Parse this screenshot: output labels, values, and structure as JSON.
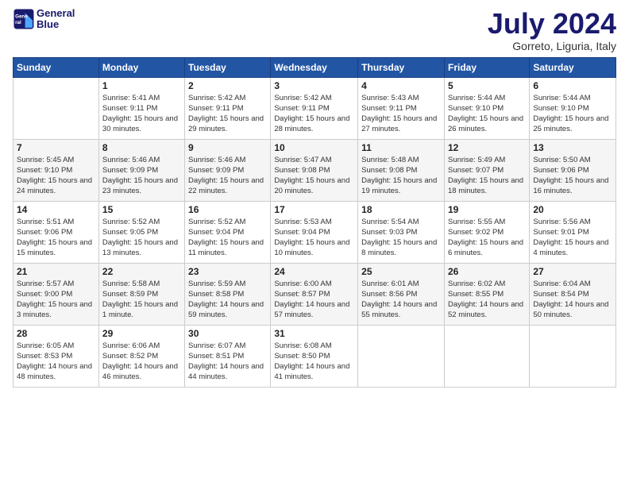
{
  "header": {
    "logo_line1": "General",
    "logo_line2": "Blue",
    "month": "July 2024",
    "location": "Gorreto, Liguria, Italy"
  },
  "days_of_week": [
    "Sunday",
    "Monday",
    "Tuesday",
    "Wednesday",
    "Thursday",
    "Friday",
    "Saturday"
  ],
  "weeks": [
    [
      {
        "day": "",
        "empty": true
      },
      {
        "day": "1",
        "sunrise": "Sunrise: 5:41 AM",
        "sunset": "Sunset: 9:11 PM",
        "daylight": "Daylight: 15 hours and 30 minutes."
      },
      {
        "day": "2",
        "sunrise": "Sunrise: 5:42 AM",
        "sunset": "Sunset: 9:11 PM",
        "daylight": "Daylight: 15 hours and 29 minutes."
      },
      {
        "day": "3",
        "sunrise": "Sunrise: 5:42 AM",
        "sunset": "Sunset: 9:11 PM",
        "daylight": "Daylight: 15 hours and 28 minutes."
      },
      {
        "day": "4",
        "sunrise": "Sunrise: 5:43 AM",
        "sunset": "Sunset: 9:11 PM",
        "daylight": "Daylight: 15 hours and 27 minutes."
      },
      {
        "day": "5",
        "sunrise": "Sunrise: 5:44 AM",
        "sunset": "Sunset: 9:10 PM",
        "daylight": "Daylight: 15 hours and 26 minutes."
      },
      {
        "day": "6",
        "sunrise": "Sunrise: 5:44 AM",
        "sunset": "Sunset: 9:10 PM",
        "daylight": "Daylight: 15 hours and 25 minutes."
      }
    ],
    [
      {
        "day": "7",
        "sunrise": "Sunrise: 5:45 AM",
        "sunset": "Sunset: 9:10 PM",
        "daylight": "Daylight: 15 hours and 24 minutes."
      },
      {
        "day": "8",
        "sunrise": "Sunrise: 5:46 AM",
        "sunset": "Sunset: 9:09 PM",
        "daylight": "Daylight: 15 hours and 23 minutes."
      },
      {
        "day": "9",
        "sunrise": "Sunrise: 5:46 AM",
        "sunset": "Sunset: 9:09 PM",
        "daylight": "Daylight: 15 hours and 22 minutes."
      },
      {
        "day": "10",
        "sunrise": "Sunrise: 5:47 AM",
        "sunset": "Sunset: 9:08 PM",
        "daylight": "Daylight: 15 hours and 20 minutes."
      },
      {
        "day": "11",
        "sunrise": "Sunrise: 5:48 AM",
        "sunset": "Sunset: 9:08 PM",
        "daylight": "Daylight: 15 hours and 19 minutes."
      },
      {
        "day": "12",
        "sunrise": "Sunrise: 5:49 AM",
        "sunset": "Sunset: 9:07 PM",
        "daylight": "Daylight: 15 hours and 18 minutes."
      },
      {
        "day": "13",
        "sunrise": "Sunrise: 5:50 AM",
        "sunset": "Sunset: 9:06 PM",
        "daylight": "Daylight: 15 hours and 16 minutes."
      }
    ],
    [
      {
        "day": "14",
        "sunrise": "Sunrise: 5:51 AM",
        "sunset": "Sunset: 9:06 PM",
        "daylight": "Daylight: 15 hours and 15 minutes."
      },
      {
        "day": "15",
        "sunrise": "Sunrise: 5:52 AM",
        "sunset": "Sunset: 9:05 PM",
        "daylight": "Daylight: 15 hours and 13 minutes."
      },
      {
        "day": "16",
        "sunrise": "Sunrise: 5:52 AM",
        "sunset": "Sunset: 9:04 PM",
        "daylight": "Daylight: 15 hours and 11 minutes."
      },
      {
        "day": "17",
        "sunrise": "Sunrise: 5:53 AM",
        "sunset": "Sunset: 9:04 PM",
        "daylight": "Daylight: 15 hours and 10 minutes."
      },
      {
        "day": "18",
        "sunrise": "Sunrise: 5:54 AM",
        "sunset": "Sunset: 9:03 PM",
        "daylight": "Daylight: 15 hours and 8 minutes."
      },
      {
        "day": "19",
        "sunrise": "Sunrise: 5:55 AM",
        "sunset": "Sunset: 9:02 PM",
        "daylight": "Daylight: 15 hours and 6 minutes."
      },
      {
        "day": "20",
        "sunrise": "Sunrise: 5:56 AM",
        "sunset": "Sunset: 9:01 PM",
        "daylight": "Daylight: 15 hours and 4 minutes."
      }
    ],
    [
      {
        "day": "21",
        "sunrise": "Sunrise: 5:57 AM",
        "sunset": "Sunset: 9:00 PM",
        "daylight": "Daylight: 15 hours and 3 minutes."
      },
      {
        "day": "22",
        "sunrise": "Sunrise: 5:58 AM",
        "sunset": "Sunset: 8:59 PM",
        "daylight": "Daylight: 15 hours and 1 minute."
      },
      {
        "day": "23",
        "sunrise": "Sunrise: 5:59 AM",
        "sunset": "Sunset: 8:58 PM",
        "daylight": "Daylight: 14 hours and 59 minutes."
      },
      {
        "day": "24",
        "sunrise": "Sunrise: 6:00 AM",
        "sunset": "Sunset: 8:57 PM",
        "daylight": "Daylight: 14 hours and 57 minutes."
      },
      {
        "day": "25",
        "sunrise": "Sunrise: 6:01 AM",
        "sunset": "Sunset: 8:56 PM",
        "daylight": "Daylight: 14 hours and 55 minutes."
      },
      {
        "day": "26",
        "sunrise": "Sunrise: 6:02 AM",
        "sunset": "Sunset: 8:55 PM",
        "daylight": "Daylight: 14 hours and 52 minutes."
      },
      {
        "day": "27",
        "sunrise": "Sunrise: 6:04 AM",
        "sunset": "Sunset: 8:54 PM",
        "daylight": "Daylight: 14 hours and 50 minutes."
      }
    ],
    [
      {
        "day": "28",
        "sunrise": "Sunrise: 6:05 AM",
        "sunset": "Sunset: 8:53 PM",
        "daylight": "Daylight: 14 hours and 48 minutes."
      },
      {
        "day": "29",
        "sunrise": "Sunrise: 6:06 AM",
        "sunset": "Sunset: 8:52 PM",
        "daylight": "Daylight: 14 hours and 46 minutes."
      },
      {
        "day": "30",
        "sunrise": "Sunrise: 6:07 AM",
        "sunset": "Sunset: 8:51 PM",
        "daylight": "Daylight: 14 hours and 44 minutes."
      },
      {
        "day": "31",
        "sunrise": "Sunrise: 6:08 AM",
        "sunset": "Sunset: 8:50 PM",
        "daylight": "Daylight: 14 hours and 41 minutes."
      },
      {
        "day": "",
        "empty": true
      },
      {
        "day": "",
        "empty": true
      },
      {
        "day": "",
        "empty": true
      }
    ]
  ]
}
